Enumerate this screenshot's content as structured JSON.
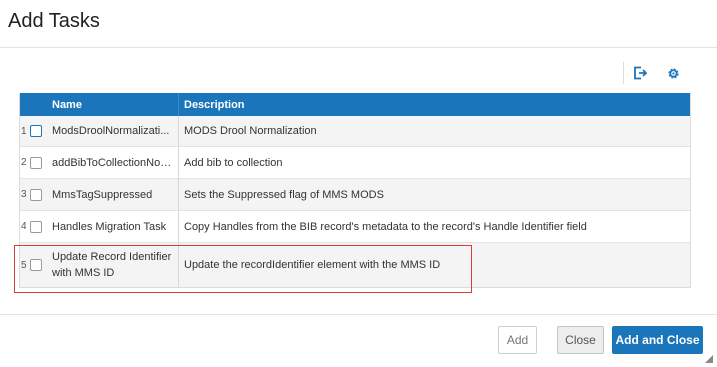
{
  "dialog": {
    "title": "Add Tasks"
  },
  "toolbar": {
    "export_icon": "export-icon",
    "settings_icon": "gear-icon"
  },
  "table": {
    "columns": {
      "name": "Name",
      "description": "Description"
    },
    "rows": [
      {
        "index": "1",
        "name": "ModsDroolNormalizati...",
        "description": "MODS Drool Normalization"
      },
      {
        "index": "2",
        "name": "addBibToCollectionNor...",
        "description": "Add bib to collection"
      },
      {
        "index": "3",
        "name": "MmsTagSuppressed",
        "description": "Sets the Suppressed flag of MMS MODS"
      },
      {
        "index": "4",
        "name": "Handles Migration Task",
        "description": "Copy Handles from the BIB record's metadata to the record's Handle Identifier field"
      },
      {
        "index": "5",
        "name": "Update Record Identifier with MMS ID",
        "description": "Update the recordIdentifier element with the MMS ID"
      }
    ]
  },
  "footer": {
    "add_label": "Add",
    "close_label": "Close",
    "add_close_label": "Add and Close"
  },
  "colors": {
    "accent": "#1b75bb",
    "highlight": "#d6403b"
  }
}
